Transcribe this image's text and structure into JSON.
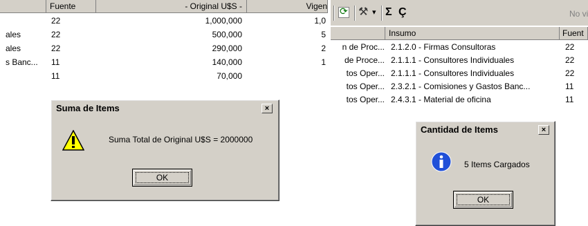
{
  "left_grid": {
    "headers": {
      "fuente": "Fuente",
      "original": "- Original U$S -",
      "vigente": "Vigen"
    },
    "rows": [
      {
        "desc": "",
        "fuente": "22",
        "original": "1,000,000",
        "vig": "1,0"
      },
      {
        "desc": "ales",
        "fuente": "22",
        "original": "500,000",
        "vig": "5"
      },
      {
        "desc": "ales",
        "fuente": "22",
        "original": "290,000",
        "vig": "2"
      },
      {
        "desc": "s Banc...",
        "fuente": "11",
        "original": "140,000",
        "vig": "1"
      },
      {
        "desc": "",
        "fuente": "11",
        "original": "70,000",
        "vig": ""
      }
    ]
  },
  "sum_dialog": {
    "title": "Suma de Items",
    "close": "×",
    "message": "Suma Total de Original U$S = 2000000",
    "ok": "OK"
  },
  "toolbar": {
    "refresh_icon": "⟳",
    "tools_icon": "⚒",
    "dropdown_arrow": "▾",
    "sum_icon": "Σ",
    "count_icon": "Ç",
    "status": "No vir"
  },
  "right_grid": {
    "headers": {
      "insumo": "Insumo",
      "fuente": "Fuent"
    },
    "rows": [
      {
        "prefix": "n de Proc...",
        "insumo": "2.1.2.0  -  Firmas Consultoras",
        "fuente": "22"
      },
      {
        "prefix": "de Proce...",
        "insumo": "2.1.1.1  -  Consultores Individuales",
        "fuente": "22"
      },
      {
        "prefix": "tos Oper...",
        "insumo": "2.1.1.1  -  Consultores Individuales",
        "fuente": "22"
      },
      {
        "prefix": "tos Oper...",
        "insumo": "2.3.2.1  -  Comisiones y Gastos Banc...",
        "fuente": "11"
      },
      {
        "prefix": "tos Oper...",
        "insumo": "2.4.3.1  -  Material de oficina",
        "fuente": "11"
      }
    ]
  },
  "count_dialog": {
    "title": "Cantidad de Items",
    "close": "×",
    "message": "5 Items Cargados",
    "ok": "OK"
  }
}
